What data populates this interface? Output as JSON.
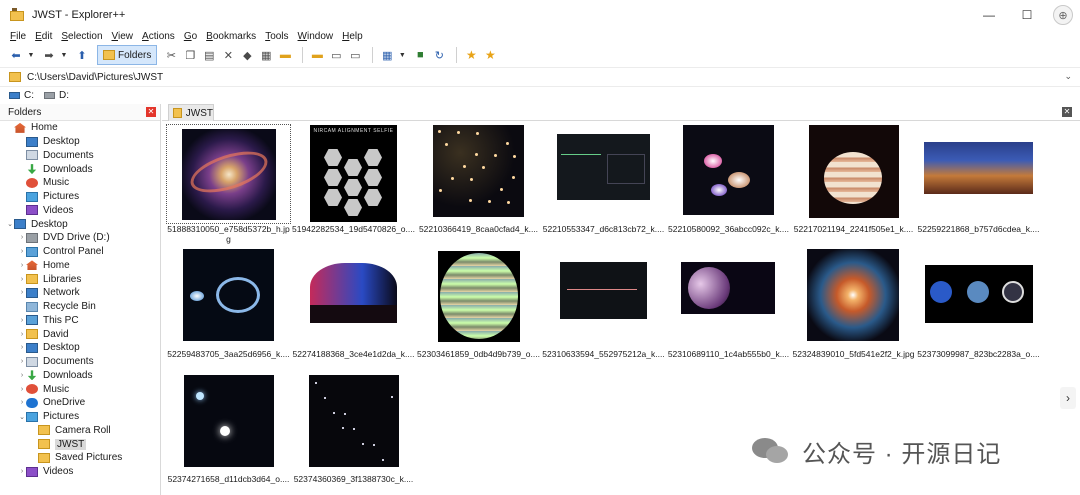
{
  "window": {
    "title": "JWST - Explorer++"
  },
  "window_controls": {
    "minimize": "—",
    "maximize": "☐",
    "close": "✕",
    "extra": "⊕"
  },
  "menubar": [
    {
      "key": "F",
      "rest": "ile"
    },
    {
      "key": "E",
      "rest": "dit"
    },
    {
      "key": "S",
      "rest": "election"
    },
    {
      "key": "V",
      "rest": "iew"
    },
    {
      "key": "A",
      "rest": "ctions"
    },
    {
      "key": "G",
      "rest": "o"
    },
    {
      "key": "B",
      "rest": "ookmarks"
    },
    {
      "key": "T",
      "rest": "ools"
    },
    {
      "key": "W",
      "rest": "indow"
    },
    {
      "key": "H",
      "rest": "elp"
    }
  ],
  "toolbar": {
    "folders_label": "Folders"
  },
  "address": {
    "path": "C:\\Users\\David\\Pictures\\JWST"
  },
  "drives": [
    {
      "label": "C:"
    },
    {
      "label": "D:"
    }
  ],
  "folders_pane": {
    "title": "Folders",
    "close": "✕",
    "items": [
      {
        "label": "Home",
        "icon": "home-icon",
        "depth": 0,
        "twisty": ""
      },
      {
        "label": "Desktop",
        "icon": "desktop-icon",
        "depth": 1,
        "twisty": ""
      },
      {
        "label": "Documents",
        "icon": "documents-icon",
        "depth": 1,
        "twisty": ""
      },
      {
        "label": "Downloads",
        "icon": "downloads-icon",
        "depth": 1,
        "twisty": ""
      },
      {
        "label": "Music",
        "icon": "music-icon",
        "depth": 1,
        "twisty": ""
      },
      {
        "label": "Pictures",
        "icon": "pictures-icon",
        "depth": 1,
        "twisty": ""
      },
      {
        "label": "Videos",
        "icon": "videos-icon",
        "depth": 1,
        "twisty": ""
      },
      {
        "label": "Desktop",
        "icon": "desktop-icon",
        "depth": 0,
        "twisty": "⌄"
      },
      {
        "label": "DVD Drive (D:)",
        "icon": "dvd-drive-icon",
        "depth": 1,
        "twisty": "›"
      },
      {
        "label": "Control Panel",
        "icon": "control-panel-icon",
        "depth": 1,
        "twisty": "›"
      },
      {
        "label": "Home",
        "icon": "home-icon",
        "depth": 1,
        "twisty": "›"
      },
      {
        "label": "Libraries",
        "icon": "libraries-icon",
        "depth": 1,
        "twisty": "›"
      },
      {
        "label": "Network",
        "icon": "network-icon",
        "depth": 1,
        "twisty": "›"
      },
      {
        "label": "Recycle Bin",
        "icon": "recycle-bin-icon",
        "depth": 1,
        "twisty": ""
      },
      {
        "label": "This PC",
        "icon": "this-pc-icon",
        "depth": 1,
        "twisty": "›"
      },
      {
        "label": "David",
        "icon": "folder-icon",
        "depth": 1,
        "twisty": "›"
      },
      {
        "label": "Desktop",
        "icon": "desktop-icon",
        "depth": 1,
        "twisty": "›"
      },
      {
        "label": "Documents",
        "icon": "documents-icon",
        "depth": 1,
        "twisty": "›"
      },
      {
        "label": "Downloads",
        "icon": "downloads-icon",
        "depth": 1,
        "twisty": "›"
      },
      {
        "label": "Music",
        "icon": "music-icon",
        "depth": 1,
        "twisty": "›"
      },
      {
        "label": "OneDrive",
        "icon": "onedrive-icon",
        "depth": 1,
        "twisty": "›"
      },
      {
        "label": "Pictures",
        "icon": "pictures-icon",
        "depth": 1,
        "twisty": "⌄"
      },
      {
        "label": "Camera Roll",
        "icon": "folder-icon",
        "depth": 2,
        "twisty": ""
      },
      {
        "label": "JWST",
        "icon": "folder-icon",
        "depth": 2,
        "twisty": "",
        "selected": true
      },
      {
        "label": "Saved Pictures",
        "icon": "folder-icon",
        "depth": 2,
        "twisty": ""
      },
      {
        "label": "Videos",
        "icon": "videos-icon",
        "depth": 1,
        "twisty": "›"
      }
    ]
  },
  "tab": {
    "label": "JWST",
    "close": "✕"
  },
  "files": [
    {
      "name": "51888310050_e758d5372b_h.jpg",
      "art": "spiral-galaxy",
      "selected": true
    },
    {
      "name": "51942282534_19d5470826_o....",
      "art": "mirror-selfie",
      "overlay": "NIRCAM ALIGNMENT SELFIE"
    },
    {
      "name": "52210366419_8caa0cfad4_k....",
      "art": "deep-field"
    },
    {
      "name": "52210553347_d6c813cb72_k....",
      "art": "spectrum-chart"
    },
    {
      "name": "52210580092_36abcc092c_k....",
      "art": "quintet"
    },
    {
      "name": "52217021194_2241f505e1_k....",
      "art": "jupiter"
    },
    {
      "name": "52259221868_b757d6cdea_k....",
      "art": "cosmic-cliffs"
    },
    {
      "name": "52259483705_3aa25d6956_k....",
      "art": "cartwheel"
    },
    {
      "name": "52274188368_3ce4e1d2da_k....",
      "art": "planetarium"
    },
    {
      "name": "52303461859_0db4d9b739_o....",
      "art": "jupiter-ir"
    },
    {
      "name": "52310633594_552975212a_k....",
      "art": "spectrum-chart2"
    },
    {
      "name": "52310689110_1c4ab555b0_k....",
      "art": "exoplanet"
    },
    {
      "name": "52324839010_5fd541e2f2_k.jpg",
      "art": "phantom-galaxy"
    },
    {
      "name": "52373099987_823bc2283a_o....",
      "art": "neptune-panels"
    },
    {
      "name": "52374271658_d11dcb3d64_o....",
      "art": "star-field"
    },
    {
      "name": "52374360369_3f1388730c_k....",
      "art": "dark-field"
    }
  ],
  "watermark": {
    "text": "公众号 · 开源日记"
  },
  "colors": {
    "selection_bg": "#d9d9d9",
    "folders_button_bg": "#d5e7fb",
    "accent_blue": "#2b5fad"
  }
}
